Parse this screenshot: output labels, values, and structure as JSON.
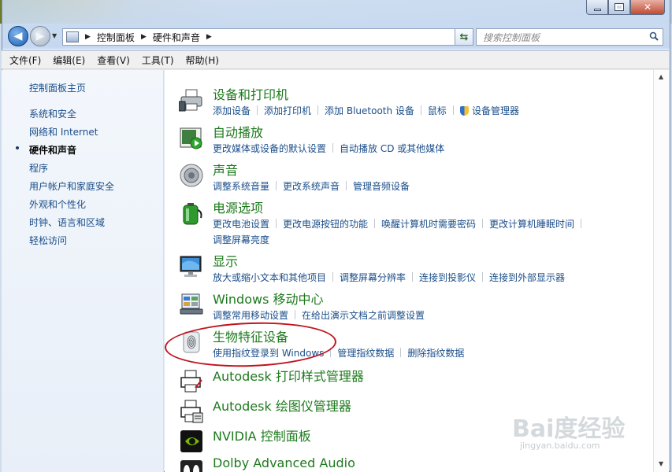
{
  "window": {
    "breadcrumb": [
      "控制面板",
      "硬件和声音"
    ],
    "search_placeholder": "搜索控制面板"
  },
  "menubar": [
    "文件(F)",
    "编辑(E)",
    "查看(V)",
    "工具(T)",
    "帮助(H)"
  ],
  "sidebar": {
    "home": "控制面板主页",
    "items": [
      "系统和安全",
      "网络和 Internet",
      "硬件和声音",
      "程序",
      "用户帐户和家庭安全",
      "外观和个性化",
      "时钟、语言和区域",
      "轻松访问"
    ],
    "current_index": 2
  },
  "categories": [
    {
      "title": "设备和打印机",
      "icon": "printer-icon",
      "links": [
        "添加设备",
        "添加打印机",
        "添加 Bluetooth 设备",
        "鼠标",
        "设备管理器"
      ]
    },
    {
      "title": "自动播放",
      "icon": "autoplay-icon",
      "links": [
        "更改媒体或设备的默认设置",
        "自动播放 CD 或其他媒体"
      ]
    },
    {
      "title": "声音",
      "icon": "speaker-icon",
      "links": [
        "调整系统音量",
        "更改系统声音",
        "管理音频设备"
      ]
    },
    {
      "title": "电源选项",
      "icon": "battery-icon",
      "links": [
        "更改电池设置",
        "更改电源按钮的功能",
        "唤醒计算机时需要密码",
        "更改计算机睡眠时间",
        "调整屏幕亮度"
      ]
    },
    {
      "title": "显示",
      "icon": "monitor-icon",
      "links": [
        "放大或缩小文本和其他项目",
        "调整屏幕分辨率",
        "连接到投影仪",
        "连接到外部显示器"
      ]
    },
    {
      "title": "Windows 移动中心",
      "icon": "mobility-center-icon",
      "links": [
        "调整常用移动设置",
        "在给出演示文档之前调整设置"
      ]
    },
    {
      "title": "生物特征设备",
      "icon": "fingerprint-icon",
      "links": [
        "使用指纹登录到 Windows",
        "管理指纹数据",
        "删除指纹数据"
      ]
    },
    {
      "title": "Autodesk 打印样式管理器",
      "icon": "autodesk-print-style-icon",
      "links": []
    },
    {
      "title": "Autodesk 绘图仪管理器",
      "icon": "autodesk-plotter-icon",
      "links": []
    },
    {
      "title": "NVIDIA 控制面板",
      "icon": "nvidia-icon",
      "links": []
    },
    {
      "title": "Dolby Advanced Audio",
      "icon": "dolby-icon",
      "links": []
    }
  ],
  "watermark": {
    "logo": "Bai度经验",
    "url": "jingyan.baidu.com"
  },
  "colors": {
    "link": "#1b4e8a",
    "category_title": "#1d7a1d",
    "highlight": "#c0141f"
  }
}
